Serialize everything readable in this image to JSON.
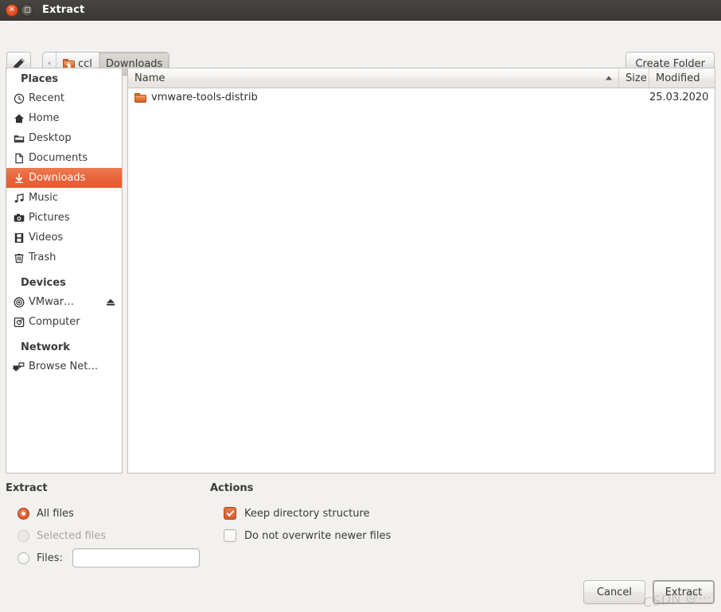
{
  "window": {
    "title": "Extract",
    "close_label": "×",
    "maximize_label": ""
  },
  "toolbar": {
    "location_button_icon": "pencil-icon",
    "create_folder_label": "Create Folder",
    "path": {
      "back_arrow": "‹",
      "segments": [
        {
          "label": "ccl",
          "icon": "home-folder-icon",
          "active": false
        },
        {
          "label": "Downloads",
          "icon": "",
          "active": true
        }
      ]
    }
  },
  "sidebar": {
    "sections": [
      {
        "title": "Places",
        "items": [
          {
            "label": "Recent",
            "icon": "clock-icon"
          },
          {
            "label": "Home",
            "icon": "home-icon"
          },
          {
            "label": "Desktop",
            "icon": "desktop-folder-icon"
          },
          {
            "label": "Documents",
            "icon": "document-icon"
          },
          {
            "label": "Downloads",
            "icon": "download-arrow-icon"
          },
          {
            "label": "Music",
            "icon": "music-note-icon"
          },
          {
            "label": "Pictures",
            "icon": "camera-icon"
          },
          {
            "label": "Videos",
            "icon": "film-icon"
          },
          {
            "label": "Trash",
            "icon": "trash-icon"
          }
        ]
      },
      {
        "title": "Devices",
        "items": [
          {
            "label": "VMwar…",
            "icon": "disc-icon"
          },
          {
            "label": "Computer",
            "icon": "computer-icon"
          }
        ]
      },
      {
        "title": "Network",
        "items": [
          {
            "label": "Browse Net…",
            "icon": "network-icon"
          }
        ]
      }
    ],
    "selected": "Downloads"
  },
  "filelist": {
    "columns": [
      "Name",
      "Size",
      "Modified"
    ],
    "sort_column": "Name",
    "sort_direction": "ascending",
    "rows": [
      {
        "name": "vmware-tools-distrib",
        "size": "",
        "modified": "25.03.2020",
        "icon": "folder-icon"
      }
    ]
  },
  "options": {
    "extract": {
      "title": "Extract",
      "all_files_label": "All files",
      "selected_files_label": "Selected files",
      "files_label": "Files:",
      "files_value": "",
      "files_placeholder": "",
      "selected": "All files"
    },
    "actions": {
      "title": "Actions",
      "keep_structure_label": "Keep directory structure",
      "keep_structure_checked": true,
      "no_overwrite_label": "Do not overwrite newer files",
      "no_overwrite_checked": false
    }
  },
  "buttons": {
    "cancel_label": "Cancel",
    "extract_label": "Extract"
  },
  "watermark": {
    "text": "CSDN @…"
  },
  "colors": {
    "accent_orange": "#e35c2e",
    "titlebar": "#3b3935",
    "window_bg": "#f2f1f0",
    "panel_bg": "#ffffff"
  }
}
